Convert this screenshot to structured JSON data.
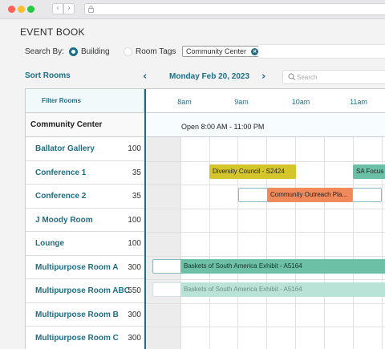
{
  "header": {
    "title": "EVENT BOOK",
    "search_by_label": "Search By:",
    "radio_building": "Building",
    "radio_room_tags": "Room Tags",
    "chip_label": "Community Center"
  },
  "toolbar": {
    "sort_rooms": "Sort Rooms",
    "date": "Monday Feb 20, 2023",
    "search_placeholder": "Search"
  },
  "grid": {
    "filter_rooms": "Filter Rooms",
    "building": "Community Center",
    "open_hours": "Open 8:00 AM - 11:00 PM",
    "times": [
      "8am",
      "9am",
      "10am",
      "11am"
    ],
    "rooms": [
      {
        "name": "Ballator Gallery",
        "capacity": "100"
      },
      {
        "name": "Conference 1",
        "capacity": "35"
      },
      {
        "name": "Conference 2",
        "capacity": "35"
      },
      {
        "name": "J Moody Room",
        "capacity": "100"
      },
      {
        "name": "Lounge",
        "capacity": "100"
      },
      {
        "name": "Multipurpose Room A",
        "capacity": "300"
      },
      {
        "name": "Multipurpose Room ABC",
        "capacity": "550"
      },
      {
        "name": "Multipurpose Room B",
        "capacity": "300"
      },
      {
        "name": "Multipurpose Room C",
        "capacity": "300"
      }
    ],
    "events": {
      "diversity_council": {
        "label": "Diversity Council - S2424",
        "color": "#d4c62a"
      },
      "sa_focus": {
        "label": "SA Focus G",
        "color": "#6cc0a6"
      },
      "community_outreach": {
        "label": "Community Outreach Pla...",
        "color": "#f08a5d"
      },
      "baskets": {
        "label": "Baskets of South America Exhibit - A5164",
        "color": "#6cc0a6"
      },
      "baskets_faded": {
        "label": "Baskets of South America Exhibit - A5164",
        "color": "#b9e3d6"
      }
    }
  },
  "colors": {
    "accent": "#1f6e83"
  }
}
